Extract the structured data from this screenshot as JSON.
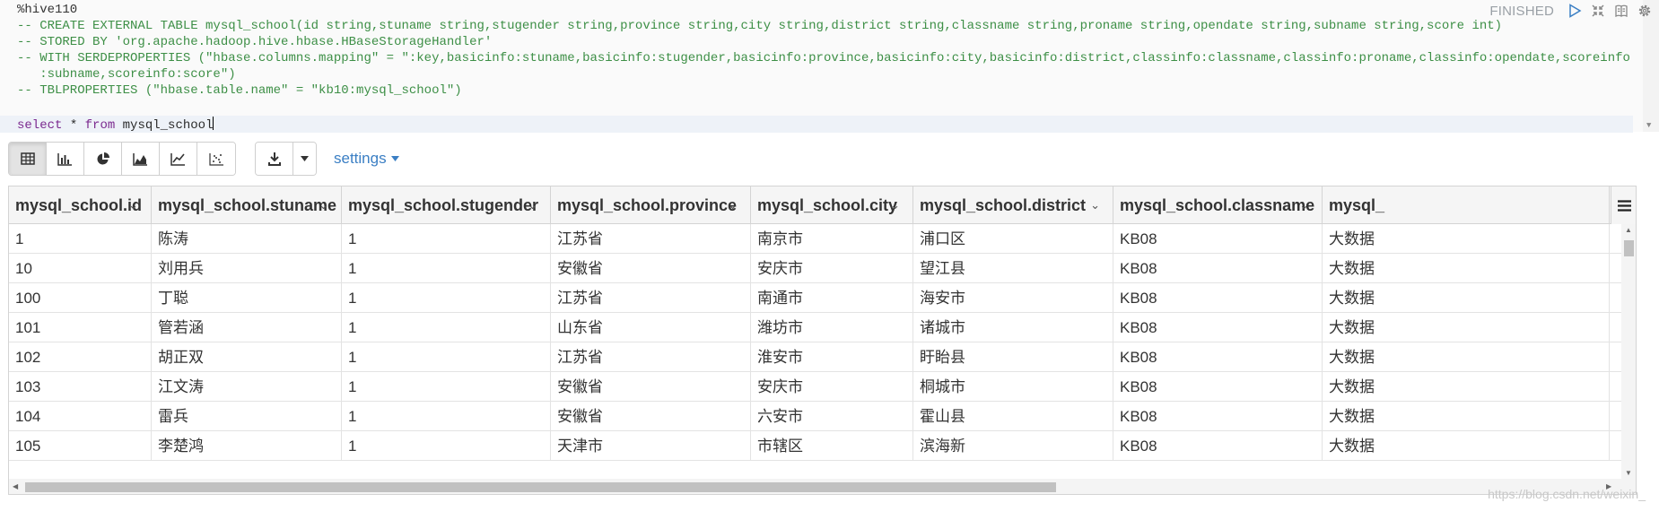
{
  "editor": {
    "interpreter": "%hive110",
    "comment_lines": [
      "-- CREATE EXTERNAL TABLE mysql_school(id string,stuname string,stugender string,province string,city string,district string,classname string,proname string,opendate string,subname string,score int)",
      "-- STORED BY 'org.apache.hadoop.hive.hbase.HBaseStorageHandler'",
      "-- WITH SERDEPROPERTIES (\"hbase.columns.mapping\" = \":key,basicinfo:stuname,basicinfo:stugender,basicinfo:province,basicinfo:city,basicinfo:district,classinfo:classname,classinfo:proname,classinfo:opendate,scoreinfo",
      "   :subname,scoreinfo:score\")",
      "-- TBLPROPERTIES (\"hbase.table.name\" = \"kb10:mysql_school\")"
    ],
    "query": {
      "kw_select": "select",
      "star": " * ",
      "kw_from": "from",
      "table": " mysql_school"
    }
  },
  "paragraph": {
    "status": "FINISHED",
    "icons": [
      "run-icon",
      "collapse-icon",
      "book-icon",
      "gear-icon"
    ]
  },
  "toolbar": {
    "views": [
      "table-view-icon",
      "bar-chart-icon",
      "pie-chart-icon",
      "area-chart-icon",
      "line-chart-icon",
      "scatter-chart-icon"
    ],
    "active_view": "table-view-icon",
    "settings_label": "settings"
  },
  "table": {
    "columns": [
      "mysql_school.id",
      "mysql_school.stuname",
      "mysql_school.stugender",
      "mysql_school.province",
      "mysql_school.city",
      "mysql_school.district",
      "mysql_school.classname",
      "mysql_"
    ],
    "rows": [
      [
        "1",
        "陈涛",
        "1",
        "江苏省",
        "南京市",
        "浦口区",
        "KB08",
        "大数据"
      ],
      [
        "10",
        "刘用兵",
        "1",
        "安徽省",
        "安庆市",
        "望江县",
        "KB08",
        "大数据"
      ],
      [
        "100",
        "丁聪",
        "1",
        "江苏省",
        "南通市",
        "海安市",
        "KB08",
        "大数据"
      ],
      [
        "101",
        "管若涵",
        "1",
        "山东省",
        "潍坊市",
        "诸城市",
        "KB08",
        "大数据"
      ],
      [
        "102",
        "胡正双",
        "1",
        "江苏省",
        "淮安市",
        "盱眙县",
        "KB08",
        "大数据"
      ],
      [
        "103",
        "江文涛",
        "1",
        "安徽省",
        "安庆市",
        "桐城市",
        "KB08",
        "大数据"
      ],
      [
        "104",
        "雷兵",
        "1",
        "安徽省",
        "六安市",
        "霍山县",
        "KB08",
        "大数据"
      ],
      [
        "105",
        "李楚鸿",
        "1",
        "天津市",
        "市辖区",
        "滨海新",
        "KB08",
        "大数据"
      ]
    ]
  },
  "watermark": "https://blog.csdn.net/weixin_"
}
